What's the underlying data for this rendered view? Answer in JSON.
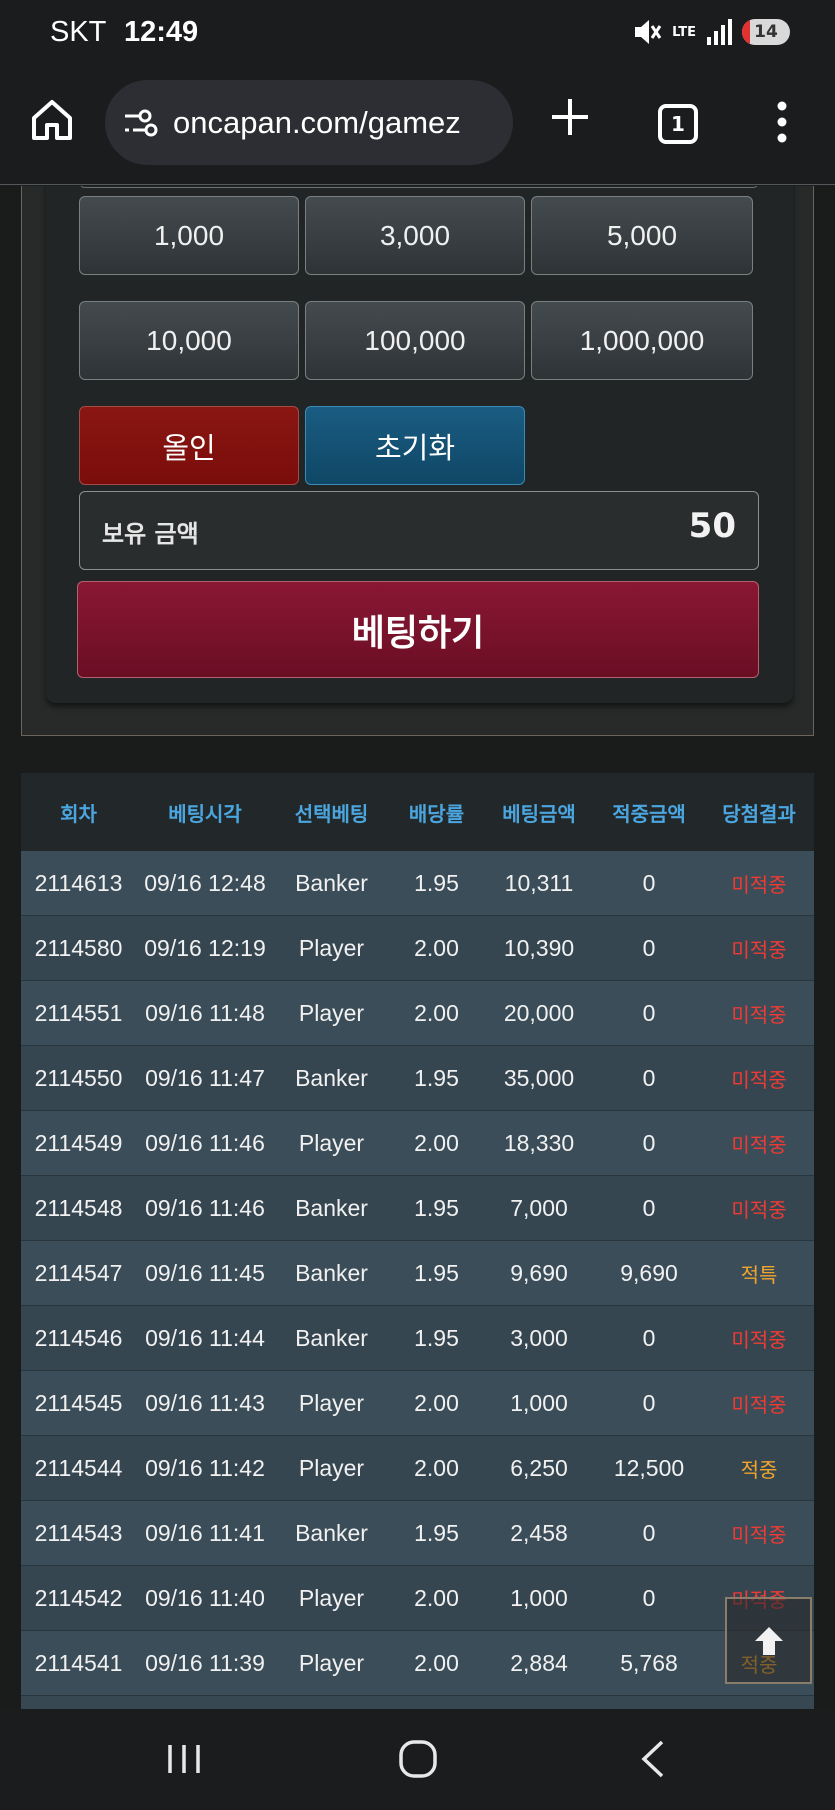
{
  "status_bar": {
    "carrier": "SKT",
    "time": "12:49",
    "network": "LTE",
    "battery": "14"
  },
  "browser": {
    "url": "oncapan.com/gamez",
    "tab_count": "1"
  },
  "bet_panel": {
    "chips": [
      "1,000",
      "3,000",
      "5,000",
      "10,000",
      "100,000",
      "1,000,000"
    ],
    "all_in_label": "올인",
    "reset_label": "초기화",
    "balance_label": "보유 금액",
    "balance_value": "50",
    "bet_button_label": "베팅하기"
  },
  "history": {
    "headers": [
      "회차",
      "베팅시각",
      "선택베팅",
      "배당률",
      "베팅금액",
      "적중금액",
      "당첨결과"
    ],
    "rows": [
      {
        "round": "2114613",
        "time": "09/16 12:48",
        "pick": "Banker",
        "odds": "1.95",
        "bet": "10,311",
        "win": "0",
        "result": "미적중",
        "result_type": "miss"
      },
      {
        "round": "2114580",
        "time": "09/16 12:19",
        "pick": "Player",
        "odds": "2.00",
        "bet": "10,390",
        "win": "0",
        "result": "미적중",
        "result_type": "miss"
      },
      {
        "round": "2114551",
        "time": "09/16 11:48",
        "pick": "Player",
        "odds": "2.00",
        "bet": "20,000",
        "win": "0",
        "result": "미적중",
        "result_type": "miss"
      },
      {
        "round": "2114550",
        "time": "09/16 11:47",
        "pick": "Banker",
        "odds": "1.95",
        "bet": "35,000",
        "win": "0",
        "result": "미적중",
        "result_type": "miss"
      },
      {
        "round": "2114549",
        "time": "09/16 11:46",
        "pick": "Player",
        "odds": "2.00",
        "bet": "18,330",
        "win": "0",
        "result": "미적중",
        "result_type": "miss"
      },
      {
        "round": "2114548",
        "time": "09/16 11:46",
        "pick": "Banker",
        "odds": "1.95",
        "bet": "7,000",
        "win": "0",
        "result": "미적중",
        "result_type": "miss"
      },
      {
        "round": "2114547",
        "time": "09/16 11:45",
        "pick": "Banker",
        "odds": "1.95",
        "bet": "9,690",
        "win": "9,690",
        "result": "적특",
        "result_type": "hit"
      },
      {
        "round": "2114546",
        "time": "09/16 11:44",
        "pick": "Banker",
        "odds": "1.95",
        "bet": "3,000",
        "win": "0",
        "result": "미적중",
        "result_type": "miss"
      },
      {
        "round": "2114545",
        "time": "09/16 11:43",
        "pick": "Player",
        "odds": "2.00",
        "bet": "1,000",
        "win": "0",
        "result": "미적중",
        "result_type": "miss"
      },
      {
        "round": "2114544",
        "time": "09/16 11:42",
        "pick": "Player",
        "odds": "2.00",
        "bet": "6,250",
        "win": "12,500",
        "result": "적중",
        "result_type": "hit"
      },
      {
        "round": "2114543",
        "time": "09/16 11:41",
        "pick": "Banker",
        "odds": "1.95",
        "bet": "2,458",
        "win": "0",
        "result": "미적중",
        "result_type": "miss"
      },
      {
        "round": "2114542",
        "time": "09/16 11:40",
        "pick": "Player",
        "odds": "2.00",
        "bet": "1,000",
        "win": "0",
        "result": "미적중",
        "result_type": "miss"
      },
      {
        "round": "2114541",
        "time": "09/16 11:39",
        "pick": "Player",
        "odds": "2.00",
        "bet": "2,884",
        "win": "5,768",
        "result": "적중",
        "result_type": "hit"
      }
    ]
  },
  "colors": {
    "miss": "#f03a33",
    "hit": "#f0a52c",
    "header_text": "#4ba6e0"
  }
}
